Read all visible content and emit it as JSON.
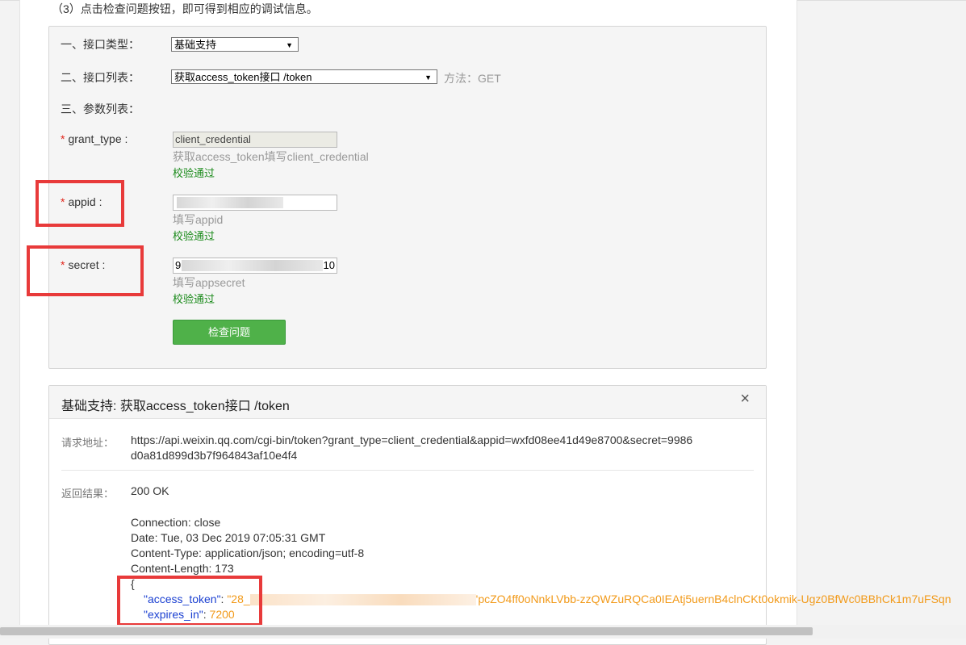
{
  "instruction": "（3）点击检查问题按钮，即可得到相应的调试信息。",
  "form": {
    "type_label": "一、接口类型：",
    "type_value": "基础支持",
    "list_label": "二、接口列表：",
    "list_value": "获取access_token接口 /token",
    "method_text": "方法：GET",
    "params_label": "三、参数列表：",
    "params": [
      {
        "name": "grant_type :",
        "value": "client_credential",
        "hint": "获取access_token填写client_credential",
        "status": "校验通过"
      },
      {
        "name": "appid :",
        "value": "",
        "hint": "填写appid",
        "status": "校验通过"
      },
      {
        "name": "secret :",
        "value_prefix": "9",
        "value_suffix": "10",
        "hint": "填写appsecret",
        "status": "校验通过"
      }
    ],
    "required_mark": "*",
    "check_button": "检查问题"
  },
  "result": {
    "title": "基础支持: 获取access_token接口 /token",
    "close_icon": "×",
    "url_label": "请求地址：",
    "url_line1": "https://api.weixin.qq.com/cgi-bin/token?grant_type=client_credential&appid=wxfd08ee41d49e8700&secret=9986",
    "url_line2": "d0a81d899d3b7f964843af10e4f4",
    "return_label": "返回结果：",
    "status": "200 OK",
    "headers": [
      "Connection: close",
      "Date: Tue, 03 Dec 2019 07:05:31 GMT",
      "Content-Type: application/json; encoding=utf-8",
      "Content-Length: 173"
    ],
    "json_open": "{",
    "token_key": "\"access_token\"",
    "token_value_prefix": "\"28_",
    "token_value_suffix": "'pcZO4ff0oNnkLVbb-zzQWZuRQCa0IEAtj5uernB4clnCKt0okmik-Ugz0BfWc0BBhCk1m7uFSqn",
    "expires_key": "\"expires_in\"",
    "expires_value": "7200"
  },
  "colors": {
    "highlight": "#e83a3a",
    "button": "#4fb149",
    "ok_text": "#1a8a1a",
    "json_key": "#1a3fd1",
    "json_value": "#f29a1a"
  }
}
